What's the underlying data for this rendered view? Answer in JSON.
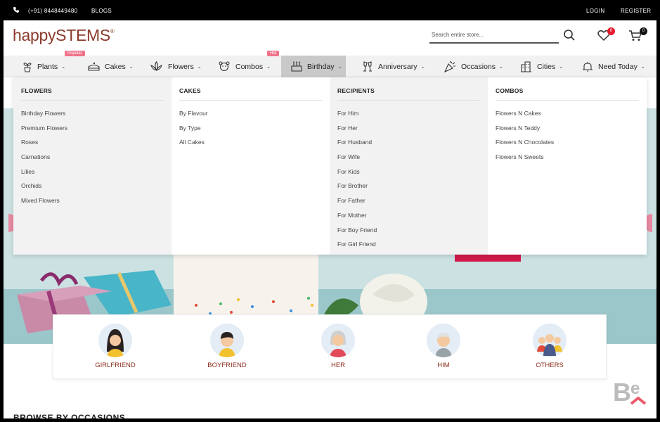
{
  "topbar": {
    "phone": "(+91) 8448449480",
    "blogs": "BLOGS",
    "login": "LOGIN",
    "register": "REGISTER"
  },
  "header": {
    "logo": "happySTEMS",
    "logo_mark": "®",
    "search_placeholder": "Search entire store...",
    "wishlist_count": "0",
    "cart_count": "0"
  },
  "nav": {
    "items": [
      {
        "label": "Plants",
        "icon": "plant-icon",
        "tag": "Popular"
      },
      {
        "label": "Cakes",
        "icon": "cake-icon",
        "tag": ""
      },
      {
        "label": "Flowers",
        "icon": "flower-icon",
        "tag": ""
      },
      {
        "label": "Combos",
        "icon": "teddy-icon",
        "tag": "Hot"
      },
      {
        "label": "Birthday",
        "icon": "birthday-cake-icon",
        "tag": ""
      },
      {
        "label": "Anniversary",
        "icon": "glasses-icon",
        "tag": ""
      },
      {
        "label": "Occasions",
        "icon": "confetti-icon",
        "tag": ""
      },
      {
        "label": "Cities",
        "icon": "city-icon",
        "tag": ""
      },
      {
        "label": "Need Today",
        "icon": "bell-icon",
        "tag": ""
      }
    ],
    "active": "Birthday"
  },
  "mega_menu": {
    "columns": [
      {
        "title": "FLOWERS",
        "items": [
          "Birthday Flowers",
          "Premium Flowers",
          "Roses",
          "Carnations",
          "Lilies",
          "Orchids",
          "Mixed Flowers"
        ]
      },
      {
        "title": "CAKES",
        "items": [
          "By Flavour",
          "By Type",
          "All Cakes"
        ]
      },
      {
        "title": "RECIPIENTS",
        "items": [
          "For Him",
          "For Her",
          "For Husband",
          "For Wife",
          "For Kids",
          "For Brother",
          "For Father",
          "For Mother",
          "For Boy Friend",
          "For Girl Friend"
        ]
      },
      {
        "title": "COMBOS",
        "items": [
          "Flowers N Cakes",
          "Flowers N Teddy",
          "Flowers N Chocolates",
          "Flowers N Sweets"
        ]
      }
    ]
  },
  "recipients": [
    {
      "label": "GIRLFRIEND"
    },
    {
      "label": "BOYFRIEND"
    },
    {
      "label": "HER"
    },
    {
      "label": "HIM"
    },
    {
      "label": "OTHERS"
    }
  ],
  "browse_heading": "BROWSE BY OCCASIONS",
  "colors": {
    "brand": "#8b3a2c",
    "accent": "#d2184b",
    "hero_bg": "#cbe1e2"
  }
}
